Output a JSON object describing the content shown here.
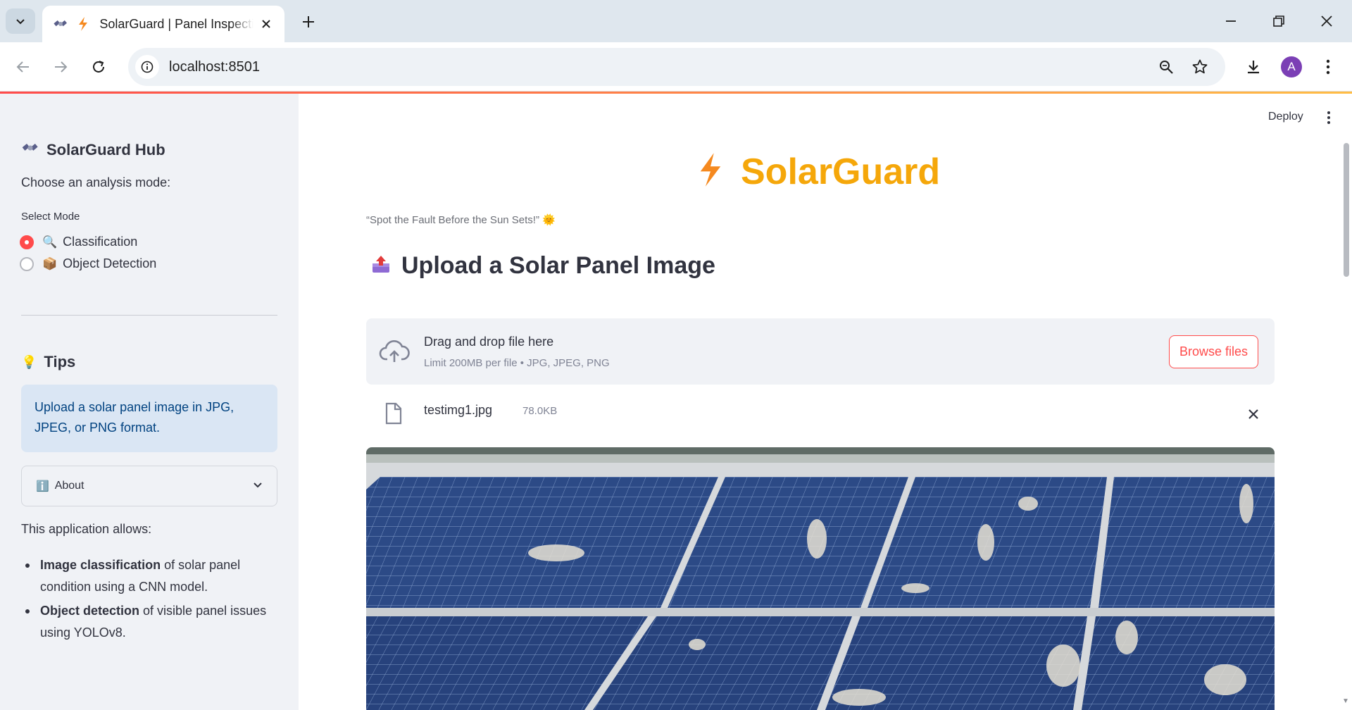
{
  "browser": {
    "tab_title": "SolarGuard | Panel Inspection",
    "url": "localhost:8501",
    "avatar_letter": "A",
    "icons": [
      "tab-search-icon",
      "satellite-icon",
      "lightning-icon",
      "close-icon",
      "plus-icon",
      "minimize-icon",
      "restore-icon",
      "close-window-icon",
      "back-icon",
      "forward-icon",
      "reload-icon",
      "info-icon",
      "zoom-icon",
      "star-icon",
      "download-icon",
      "more-vert-icon"
    ]
  },
  "sidebar": {
    "title": "SolarGuard Hub",
    "title_icon": "satellite-icon",
    "choose_text": "Choose an analysis mode:",
    "mode_label": "Select Mode",
    "options": [
      {
        "emoji": "🔍",
        "label": "Classification",
        "selected": true
      },
      {
        "emoji": "📦",
        "label": "Object Detection",
        "selected": false
      }
    ],
    "tips_heading": "Tips",
    "tips_icon": "💡",
    "info_text": "Upload a solar panel image in JPG, JPEG, or PNG format.",
    "expander": {
      "icon": "ℹ️",
      "label": "About"
    },
    "allows_text": "This application allows:",
    "features": [
      {
        "bold": "Image classification",
        "rest": " of solar panel condition using a CNN model."
      },
      {
        "bold": "Object detection",
        "rest": " of visible panel issues using YOLOv8."
      }
    ]
  },
  "header": {
    "deploy_label": "Deploy"
  },
  "main": {
    "title": "SolarGuard",
    "title_color": "#f5a70a",
    "tagline": "“Spot the Fault Before the Sun Sets!” 🌞",
    "upload_heading": "Upload a Solar Panel Image",
    "upload_icon": "📤",
    "dropzone": {
      "title": "Drag and drop file here",
      "limit": "Limit 200MB per file • JPG, JPEG, PNG",
      "browse_label": "Browse files"
    },
    "file": {
      "name": "testimg1.jpg",
      "size": "78.0KB"
    }
  },
  "colors": {
    "accent": "#ff4b4b",
    "sidebar_bg": "#f0f2f6",
    "info_bg": "#dae6f4",
    "info_text": "#004280"
  }
}
